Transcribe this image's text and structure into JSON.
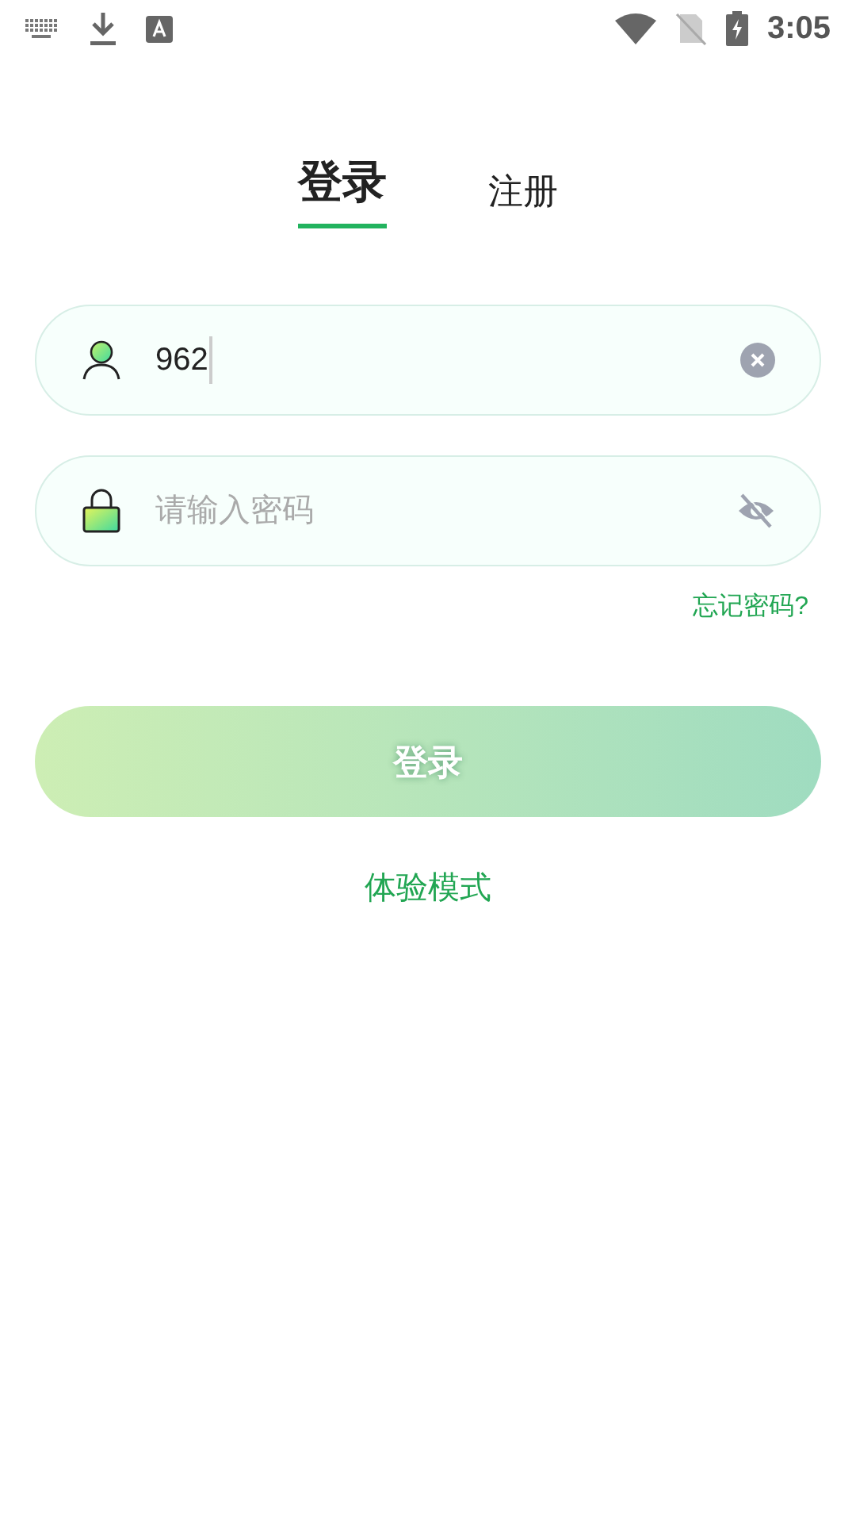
{
  "status_bar": {
    "time": "3:05"
  },
  "tabs": [
    {
      "label": "登录",
      "selected": true
    },
    {
      "label": "注册",
      "selected": false
    }
  ],
  "username_field": {
    "value": "962"
  },
  "password_field": {
    "placeholder": "请输入密码"
  },
  "forgot_password": "忘记密码?",
  "login_button": {
    "label": "登录",
    "disabled": true
  },
  "trial_mode": "体验模式"
}
